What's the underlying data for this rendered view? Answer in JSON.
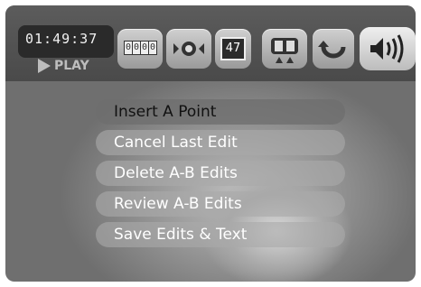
{
  "timecode": "01:49:37",
  "mode_label": "PLAY",
  "toolbar": {
    "counter_digits": [
      "0",
      "0",
      "0",
      "0"
    ],
    "clip_number": "47"
  },
  "menu": {
    "items": [
      {
        "label": "Insert A Point",
        "selected": true
      },
      {
        "label": "Cancel Last Edit",
        "selected": false
      },
      {
        "label": "Delete A-B Edits",
        "selected": false
      },
      {
        "label": "Review A-B Edits",
        "selected": false
      },
      {
        "label": "Save Edits & Text",
        "selected": false
      }
    ]
  },
  "icons": [
    "counter-icon",
    "eye-icon",
    "clip-number-icon",
    "split-screen-icon",
    "loop-icon",
    "speaker-icon"
  ]
}
